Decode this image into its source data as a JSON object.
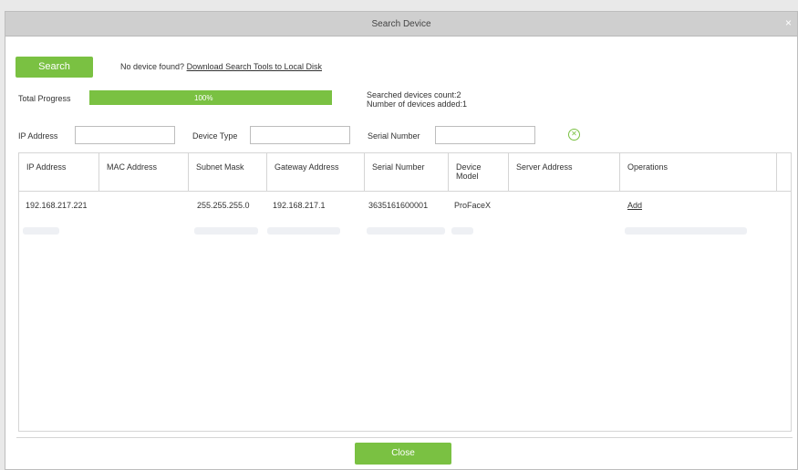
{
  "dialog": {
    "title": "Search Device",
    "close_glyph": "×"
  },
  "search": {
    "button_label": "Search",
    "no_device_text": "No device found?",
    "download_link": "Download Search Tools to Local Disk"
  },
  "progress": {
    "label": "Total Progress",
    "value_text": "100%",
    "fraction": 1.0,
    "searched_count": "Searched devices count:2",
    "added_count": "Number of devices added:1"
  },
  "filters": {
    "ip_label": "IP Address",
    "ip_value": "",
    "type_label": "Device Type",
    "type_value": "",
    "serial_label": "Serial Number",
    "serial_value": "",
    "clear_glyph": "✕"
  },
  "table": {
    "headers": [
      "IP Address",
      "MAC Address",
      "Subnet Mask",
      "Gateway Address",
      "Serial Number",
      "Device Model",
      "Server Address",
      "Operations"
    ],
    "rows": [
      {
        "ip": "192.168.217.221",
        "mac": "",
        "subnet": "255.255.255.0",
        "gateway": "192.168.217.1",
        "serial": "3635161600001",
        "model": "ProFaceX",
        "server": "",
        "operation": "Add"
      }
    ]
  },
  "footer": {
    "close_label": "Close"
  },
  "colors": {
    "accent": "#7ac142",
    "titlebar": "#cfcfcf"
  }
}
